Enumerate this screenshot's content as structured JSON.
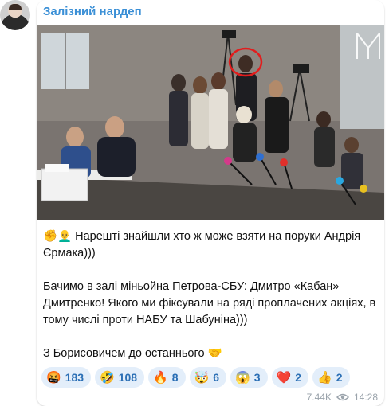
{
  "channel": {
    "name": "Залізний нардеп"
  },
  "message": {
    "line1": "✊👨‍🦲 Нарешті знайшли хто ж може взяти на поруки Андрія Єрмака)))",
    "line2": "Бачимо в залі міньойна Петрова-СБУ: Дмитро «Кабан» Дмитренко! Якого ми фіксували на ряді проплачених акціях, в тому числі проти НАБУ та Шабуніна)))",
    "line3": "З Борисовичем до останнього 🤝"
  },
  "reactions": [
    {
      "emoji": "🤬",
      "count": "183"
    },
    {
      "emoji": "🤣",
      "count": "108"
    },
    {
      "emoji": "🔥",
      "count": "8"
    },
    {
      "emoji": "🤯",
      "count": "6"
    },
    {
      "emoji": "😱",
      "count": "3"
    },
    {
      "emoji": "❤️",
      "count": "2"
    },
    {
      "emoji": "👍",
      "count": "2"
    }
  ],
  "meta": {
    "views": "7.44K",
    "time": "14:28"
  },
  "colors": {
    "accent": "#3a8fd6",
    "reaction_bg": "#e3eefa"
  }
}
